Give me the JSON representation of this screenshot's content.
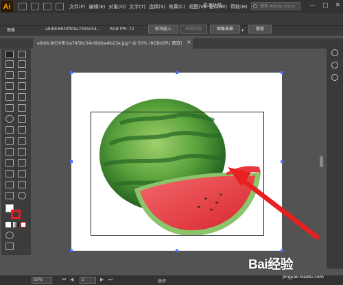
{
  "menubar": {
    "logo": "Ai",
    "items": [
      "文件(F)",
      "编辑(E)",
      "对象(O)",
      "文字(T)",
      "选择(S)",
      "效果(C)",
      "视图(V)",
      "窗口(W)",
      "帮助(H)"
    ],
    "workspace": "基本功能",
    "stock_placeholder": "搜索 Adobe Stock",
    "window_controls": [
      "—",
      "□",
      "✕"
    ]
  },
  "controlbar": {
    "label_image": "图像",
    "filename": "a9ddc8630ffcba745bc54...",
    "color_info": "RGB  PPI: 72",
    "unembed_button": "取消嵌入",
    "edit_original_button": "编辑原稿",
    "image_trace_button": "图像描摹",
    "mask_button": "蒙版"
  },
  "document_tab": {
    "title": "a9ddc8630ffcba745bc54c6bbbe4b23e.jpg* @ 50% (RGB/GPU 预览)",
    "close": "×"
  },
  "statusbar": {
    "zoom": "50%",
    "page": "1",
    "status": "选择"
  },
  "watermark": {
    "brand": "Bai经验",
    "url": "jingyan.baidu.com"
  },
  "colors": {
    "app_bg": "#535353",
    "panel_bg": "#3c3c3c",
    "menubar_bg": "#323232",
    "selection_handle": "#4a6fff",
    "arrow": "#e8201f",
    "watermelon_rind": "#2f7a2a",
    "watermelon_flesh": "#e7383f"
  }
}
